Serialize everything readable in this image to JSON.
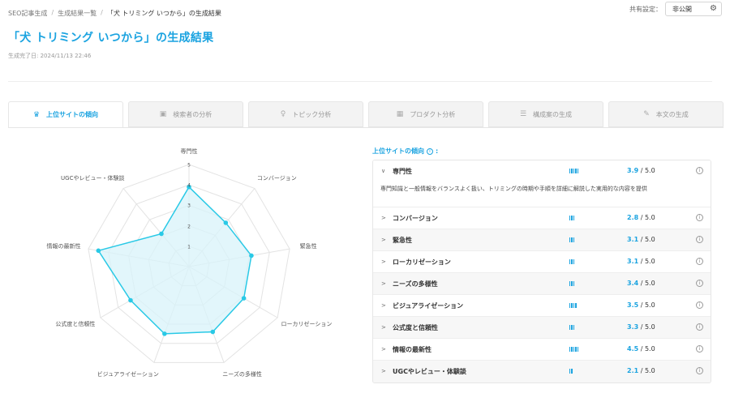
{
  "breadcrumb": [
    "SEO記事生成",
    "生成結果一覧",
    "「犬 トリミング いつから」の生成結果"
  ],
  "share": {
    "label": "共有設定：",
    "value": "非公開"
  },
  "title": "「犬 トリミング いつから」の生成結果",
  "generated_at": "生成完了日: 2024/11/13 22:46",
  "tabs": [
    {
      "label": "上位サイトの傾向",
      "icon": "crown-icon",
      "active": true
    },
    {
      "label": "検索者の分析",
      "icon": "camera-icon",
      "active": false
    },
    {
      "label": "トピック分析",
      "icon": "lightbulb-icon",
      "active": false
    },
    {
      "label": "プロダクト分析",
      "icon": "grid-icon",
      "active": false
    },
    {
      "label": "構成案の生成",
      "icon": "list-icon",
      "active": false
    },
    {
      "label": "本文の生成",
      "icon": "pencil-icon",
      "active": false
    }
  ],
  "panel": {
    "title": "上位サイトの傾向",
    "score_suffix": " / 5.0",
    "rows": [
      {
        "name": "専門性",
        "score": "3.9",
        "bars": 5,
        "expanded": true,
        "description": "専門知識と一般情報をバランスよく扱い、トリミングの時期や手順を詳細に解説した実用的な内容を提供"
      },
      {
        "name": "コンバージョン",
        "score": "2.8",
        "bars": 3
      },
      {
        "name": "緊急性",
        "score": "3.1",
        "bars": 3
      },
      {
        "name": "ローカリゼーション",
        "score": "3.1",
        "bars": 3
      },
      {
        "name": "ニーズの多様性",
        "score": "3.4",
        "bars": 3
      },
      {
        "name": "ビジュアライゼーション",
        "score": "3.5",
        "bars": 4
      },
      {
        "name": "公式度と信頼性",
        "score": "3.3",
        "bars": 3
      },
      {
        "name": "情報の最新性",
        "score": "4.5",
        "bars": 5
      },
      {
        "name": "UGCやレビュー・体験談",
        "score": "2.1",
        "bars": 2
      }
    ]
  },
  "chart_data": {
    "type": "radar",
    "categories": [
      "専門性",
      "コンバージョン",
      "緊急性",
      "ローカリゼーション",
      "ニーズの多様性",
      "ビジュアライゼーション",
      "公式度と信頼性",
      "情報の最新性",
      "UGCやレビュー・体験談"
    ],
    "values": [
      3.9,
      2.8,
      3.1,
      3.1,
      3.4,
      3.5,
      3.3,
      4.5,
      2.1
    ],
    "range": [
      0,
      5
    ],
    "ticks": [
      "1",
      "2",
      "3",
      "4",
      "5"
    ],
    "grid": true,
    "colors": {
      "line": "#29c9e6",
      "fill": "#d8f3f9",
      "grid": "#e3e3e3"
    }
  }
}
